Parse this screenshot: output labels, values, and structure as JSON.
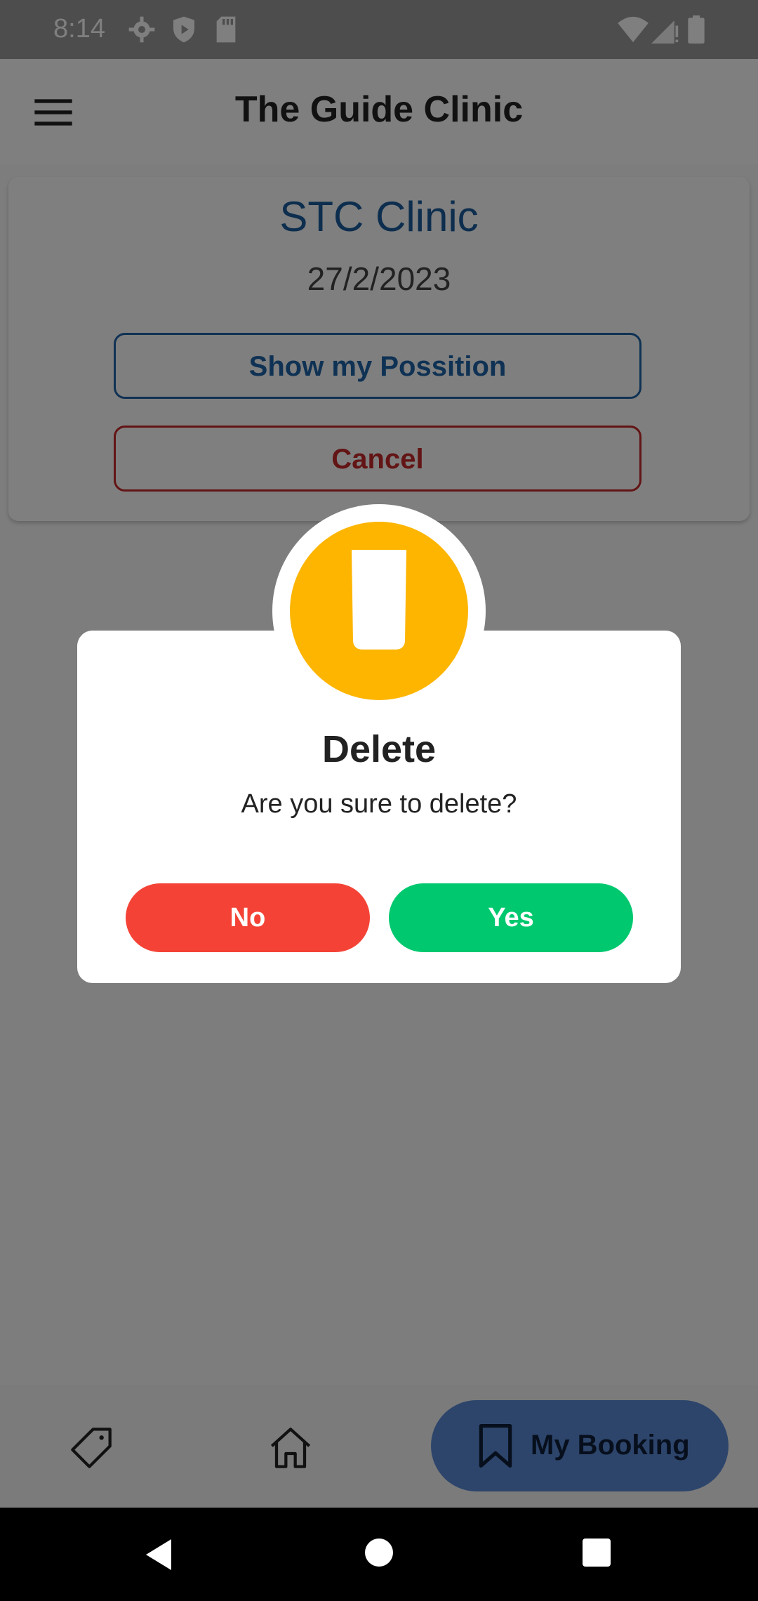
{
  "status_bar": {
    "time": "8:14",
    "icons": [
      "gear-icon",
      "shield-play-icon",
      "sd-card-icon",
      "wifi-icon",
      "signal-icon",
      "battery-icon"
    ]
  },
  "app_bar": {
    "title": "The Guide Clinic",
    "menu_icon": "menu-icon"
  },
  "booking_card": {
    "clinic_name": "STC Clinic",
    "date": "27/2/2023",
    "show_position_label": "Show my Possition",
    "cancel_label": "Cancel"
  },
  "dialog": {
    "icon": "cup-icon",
    "title": "Delete",
    "message": "Are you sure to delete?",
    "no_label": "No",
    "yes_label": "Yes"
  },
  "bottom_nav": {
    "items": [
      {
        "icon": "tag-icon",
        "label": ""
      },
      {
        "icon": "home-icon",
        "label": ""
      },
      {
        "icon": "bookmark-icon",
        "label": "My Booking",
        "active": true
      }
    ]
  },
  "colors": {
    "accent_blue": "#1f64a8",
    "cancel_red": "#c62828",
    "no_red": "#f44336",
    "yes_green": "#00c86f",
    "badge_amber": "#fdb500",
    "nav_active": "#5a8ad6"
  }
}
